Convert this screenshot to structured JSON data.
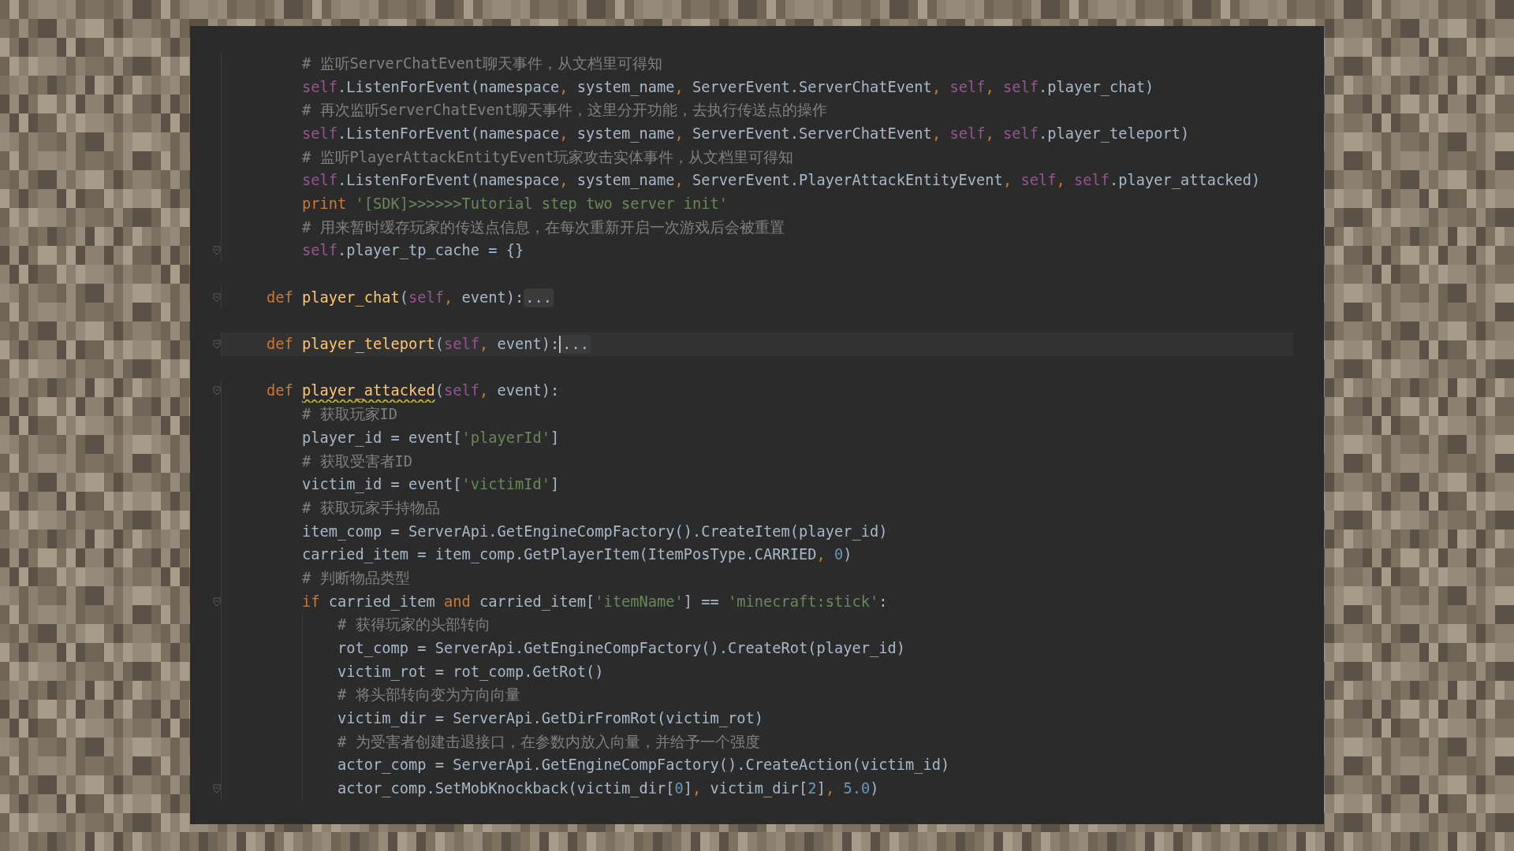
{
  "editor": {
    "lines": [
      {
        "kind": "block",
        "children": [
          {
            "kind": "code",
            "fold_marker": false,
            "tokens": [
              {
                "kind": "comment",
                "text": "# 监听ServerChatEvent聊天事件，从文档里可得知"
              }
            ]
          },
          {
            "kind": "code",
            "fold_marker": false,
            "tokens": [
              {
                "kind": "self",
                "text": "self"
              },
              {
                "kind": "plain",
                "text": ".ListenForEvent(namespace"
              },
              {
                "kind": "punct",
                "text": ", "
              },
              {
                "kind": "plain",
                "text": "system_name"
              },
              {
                "kind": "punct",
                "text": ", "
              },
              {
                "kind": "plain",
                "text": "ServerEvent.ServerChatEvent"
              },
              {
                "kind": "punct",
                "text": ", "
              },
              {
                "kind": "self",
                "text": "self"
              },
              {
                "kind": "punct",
                "text": ", "
              },
              {
                "kind": "self",
                "text": "self"
              },
              {
                "kind": "plain",
                "text": ".player_chat)"
              }
            ]
          },
          {
            "kind": "code",
            "fold_marker": false,
            "tokens": [
              {
                "kind": "comment",
                "text": "# 再次监听ServerChatEvent聊天事件，这里分开功能，去执行传送点的操作"
              }
            ]
          },
          {
            "kind": "code",
            "fold_marker": false,
            "tokens": [
              {
                "kind": "self",
                "text": "self"
              },
              {
                "kind": "plain",
                "text": ".ListenForEvent(namespace"
              },
              {
                "kind": "punct",
                "text": ", "
              },
              {
                "kind": "plain",
                "text": "system_name"
              },
              {
                "kind": "punct",
                "text": ", "
              },
              {
                "kind": "plain",
                "text": "ServerEvent.ServerChatEvent"
              },
              {
                "kind": "punct",
                "text": ", "
              },
              {
                "kind": "self",
                "text": "self"
              },
              {
                "kind": "punct",
                "text": ", "
              },
              {
                "kind": "self",
                "text": "self"
              },
              {
                "kind": "plain",
                "text": ".player_teleport)"
              }
            ]
          },
          {
            "kind": "code",
            "fold_marker": false,
            "tokens": [
              {
                "kind": "comment",
                "text": "# 监听PlayerAttackEntityEvent玩家攻击实体事件，从文档里可得知"
              }
            ]
          },
          {
            "kind": "code",
            "fold_marker": false,
            "tokens": [
              {
                "kind": "self",
                "text": "self"
              },
              {
                "kind": "plain",
                "text": ".ListenForEvent(namespace"
              },
              {
                "kind": "punct",
                "text": ", "
              },
              {
                "kind": "plain",
                "text": "system_name"
              },
              {
                "kind": "punct",
                "text": ", "
              },
              {
                "kind": "plain",
                "text": "ServerEvent.PlayerAttackEntityEvent"
              },
              {
                "kind": "punct",
                "text": ", "
              },
              {
                "kind": "self",
                "text": "self"
              },
              {
                "kind": "punct",
                "text": ", "
              },
              {
                "kind": "self",
                "text": "self"
              },
              {
                "kind": "plain",
                "text": ".player_attacked)"
              }
            ]
          },
          {
            "kind": "code",
            "fold_marker": false,
            "tokens": [
              {
                "kind": "keyword",
                "text": "print "
              },
              {
                "kind": "string",
                "text": "'[SDK]>>>>>>Tutorial step two server init'"
              }
            ]
          },
          {
            "kind": "code",
            "fold_marker": false,
            "tokens": [
              {
                "kind": "comment",
                "text": "# 用来暂时缓存玩家的传送点信息，在每次重新开启一次游戏后会被重置"
              }
            ]
          },
          {
            "kind": "code",
            "fold_marker": true,
            "tokens": [
              {
                "kind": "self",
                "text": "self"
              },
              {
                "kind": "plain",
                "text": ".player_tp_cache = {}"
              }
            ]
          }
        ]
      },
      {
        "kind": "blank"
      },
      {
        "kind": "code",
        "fold_marker": true,
        "tokens": [
          {
            "kind": "keyword",
            "text": "def "
          },
          {
            "kind": "function",
            "text": "player_chat"
          },
          {
            "kind": "plain",
            "text": "("
          },
          {
            "kind": "self",
            "text": "self"
          },
          {
            "kind": "punct",
            "text": ", "
          },
          {
            "kind": "plain",
            "text": "event):"
          },
          {
            "kind": "fold",
            "text": "..."
          }
        ]
      },
      {
        "kind": "blank"
      },
      {
        "kind": "code",
        "fold_marker": true,
        "tokens": [
          {
            "kind": "keyword",
            "text": "def "
          },
          {
            "kind": "function",
            "text": "player_teleport"
          },
          {
            "kind": "plain",
            "text": "("
          },
          {
            "kind": "self",
            "text": "self"
          },
          {
            "kind": "punct",
            "text": ", "
          },
          {
            "kind": "plain",
            "text": "event):"
          },
          {
            "kind": "caret"
          },
          {
            "kind": "fold",
            "text": "..."
          }
        ]
      },
      {
        "kind": "blank"
      },
      {
        "kind": "code",
        "fold_marker": true,
        "tokens": [
          {
            "kind": "keyword",
            "text": "def "
          },
          {
            "kind": "function-warned",
            "text": "player_attacked"
          },
          {
            "kind": "plain",
            "text": "("
          },
          {
            "kind": "self",
            "text": "self"
          },
          {
            "kind": "punct",
            "text": ", "
          },
          {
            "kind": "plain",
            "text": "event):"
          }
        ],
        "children": [
          {
            "kind": "code",
            "fold_marker": false,
            "tokens": [
              {
                "kind": "comment",
                "text": "# 获取玩家ID"
              }
            ]
          },
          {
            "kind": "code",
            "fold_marker": false,
            "tokens": [
              {
                "kind": "plain",
                "text": "player_id = event["
              },
              {
                "kind": "string",
                "text": "'playerId'"
              },
              {
                "kind": "plain",
                "text": "]"
              }
            ]
          },
          {
            "kind": "code",
            "fold_marker": false,
            "tokens": [
              {
                "kind": "comment",
                "text": "# 获取受害者ID"
              }
            ]
          },
          {
            "kind": "code",
            "fold_marker": false,
            "tokens": [
              {
                "kind": "plain",
                "text": "victim_id = event["
              },
              {
                "kind": "string",
                "text": "'victimId'"
              },
              {
                "kind": "plain",
                "text": "]"
              }
            ]
          },
          {
            "kind": "code",
            "fold_marker": false,
            "tokens": [
              {
                "kind": "comment",
                "text": "# 获取玩家手持物品"
              }
            ]
          },
          {
            "kind": "code",
            "fold_marker": false,
            "tokens": [
              {
                "kind": "plain",
                "text": "item_comp = ServerApi.GetEngineCompFactory().CreateItem(player_id)"
              }
            ]
          },
          {
            "kind": "code",
            "fold_marker": false,
            "tokens": [
              {
                "kind": "plain",
                "text": "carried_item = item_comp.GetPlayerItem(ItemPosType.CARRIED"
              },
              {
                "kind": "punct",
                "text": ", "
              },
              {
                "kind": "number",
                "text": "0"
              },
              {
                "kind": "plain",
                "text": ")"
              }
            ]
          },
          {
            "kind": "code",
            "fold_marker": false,
            "tokens": [
              {
                "kind": "comment",
                "text": "# 判断物品类型"
              }
            ]
          },
          {
            "kind": "code",
            "fold_marker": true,
            "tokens": [
              {
                "kind": "keyword",
                "text": "if"
              },
              {
                "kind": "plain",
                "text": " carried_item "
              },
              {
                "kind": "keyword",
                "text": "and"
              },
              {
                "kind": "plain",
                "text": " carried_item["
              },
              {
                "kind": "string",
                "text": "'itemName'"
              },
              {
                "kind": "plain",
                "text": "] == "
              },
              {
                "kind": "string",
                "text": "'minecraft:stick'"
              },
              {
                "kind": "plain",
                "text": ":"
              }
            ],
            "children": [
              {
                "kind": "code",
                "fold_marker": false,
                "tokens": [
                  {
                    "kind": "comment",
                    "text": "# 获得玩家的头部转向"
                  }
                ]
              },
              {
                "kind": "code",
                "fold_marker": false,
                "tokens": [
                  {
                    "kind": "plain",
                    "text": "rot_comp = ServerApi.GetEngineCompFactory().CreateRot(player_id)"
                  }
                ]
              },
              {
                "kind": "code",
                "fold_marker": false,
                "tokens": [
                  {
                    "kind": "plain",
                    "text": "victim_rot = rot_comp.GetRot()"
                  }
                ]
              },
              {
                "kind": "code",
                "fold_marker": false,
                "tokens": [
                  {
                    "kind": "comment",
                    "text": "# 将头部转向变为方向向量"
                  }
                ]
              },
              {
                "kind": "code",
                "fold_marker": false,
                "tokens": [
                  {
                    "kind": "plain",
                    "text": "victim_dir = ServerApi.GetDirFromRot(victim_rot)"
                  }
                ]
              },
              {
                "kind": "code",
                "fold_marker": false,
                "tokens": [
                  {
                    "kind": "comment",
                    "text": "# 为受害者创建击退接口，在参数内放入向量，并给予一个强度"
                  }
                ]
              },
              {
                "kind": "code",
                "fold_marker": false,
                "tokens": [
                  {
                    "kind": "plain",
                    "text": "actor_comp = ServerApi.GetEngineCompFactory().CreateAction(victim_id)"
                  }
                ]
              },
              {
                "kind": "code",
                "fold_marker": true,
                "tokens": [
                  {
                    "kind": "plain",
                    "text": "actor_comp.SetMobKnockback(victim_dir["
                  },
                  {
                    "kind": "number",
                    "text": "0"
                  },
                  {
                    "kind": "plain",
                    "text": "]"
                  },
                  {
                    "kind": "punct",
                    "text": ", "
                  },
                  {
                    "kind": "plain",
                    "text": "victim_dir["
                  },
                  {
                    "kind": "number",
                    "text": "2"
                  },
                  {
                    "kind": "plain",
                    "text": "]"
                  },
                  {
                    "kind": "punct",
                    "text": ", "
                  },
                  {
                    "kind": "number",
                    "text": "5.0"
                  },
                  {
                    "kind": "plain",
                    "text": ")"
                  }
                ]
              }
            ]
          }
        ]
      }
    ]
  }
}
